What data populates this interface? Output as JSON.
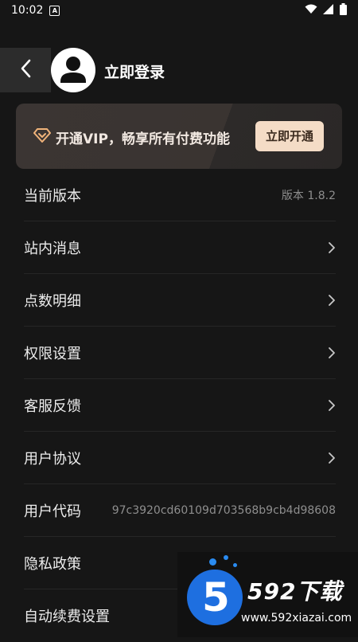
{
  "status_bar": {
    "time": "10:02",
    "notification_icon": "A"
  },
  "header": {
    "back_icon": "chevron-left-icon",
    "avatar_icon": "user-icon",
    "login_label": "立即登录"
  },
  "vip_banner": {
    "icon": "diamond-icon",
    "text": "开通VIP，畅享所有付费功能",
    "button_label": "立即开通",
    "accent_color": "#f4dcc6"
  },
  "menu": {
    "items": [
      {
        "label": "当前版本",
        "value": "版本 1.8.2"
      },
      {
        "label": "站内消息"
      },
      {
        "label": "点数明细"
      },
      {
        "label": "权限设置"
      },
      {
        "label": "客服反馈"
      },
      {
        "label": "用户协议"
      },
      {
        "label": "用户代码",
        "value": "97c3920cd60109d703568b9cb4d98608"
      },
      {
        "label": "隐私政策"
      },
      {
        "label": "自动续费设置"
      }
    ]
  },
  "watermark": {
    "digit": "5",
    "brand": "592下载",
    "url": "www.592xiazai.com"
  }
}
